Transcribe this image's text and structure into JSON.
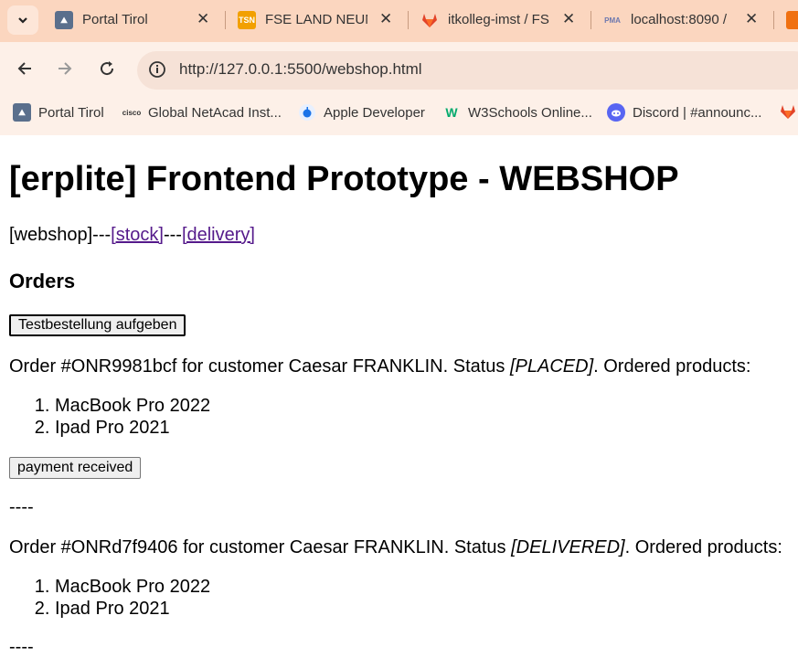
{
  "browser": {
    "tabs": [
      {
        "title": "Portal Tirol"
      },
      {
        "title": "FSE LAND NEUN"
      },
      {
        "title": "itkolleg-imst / FS"
      },
      {
        "title": "localhost:8090 / "
      }
    ],
    "url": "http://127.0.0.1:5500/webshop.html",
    "bookmarks": [
      {
        "label": "Portal Tirol"
      },
      {
        "label": "Global NetAcad Inst..."
      },
      {
        "label": "Apple Developer"
      },
      {
        "label": "W3Schools Online..."
      },
      {
        "label": "Discord | #announc..."
      }
    ]
  },
  "page": {
    "title": "[erplite] Frontend Prototype - WEBSHOP",
    "nav": {
      "current": "[webshop]",
      "sep1": "---",
      "stock": "[stock]",
      "sep2": "---",
      "delivery": "[delivery]"
    },
    "orders_heading": "Orders",
    "test_order_button": "Testbestellung aufgeben",
    "orders": [
      {
        "prefix": "Order #ONR9981bcf for customer Caesar FRANKLIN. Status ",
        "status": "[PLACED]",
        "suffix": ". Ordered products:",
        "products": [
          "MacBook Pro 2022",
          "Ipad Pro 2021"
        ],
        "action": "payment received",
        "separator": "----"
      },
      {
        "prefix": "Order #ONRd7f9406 for customer Caesar FRANKLIN. Status ",
        "status": "[DELIVERED]",
        "suffix": ". Ordered products:",
        "products": [
          "MacBook Pro 2022",
          "Ipad Pro 2021"
        ],
        "separator": "----"
      }
    ]
  }
}
